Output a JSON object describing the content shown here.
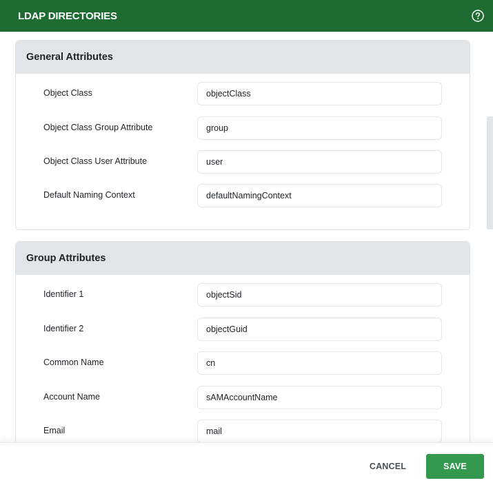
{
  "header": {
    "title": "LDAP DIRECTORIES",
    "help_icon": "help-circle-icon"
  },
  "sections": [
    {
      "title": "General Attributes",
      "fields": [
        {
          "label": "Object Class",
          "value": "objectClass"
        },
        {
          "label": "Object Class Group Attribute",
          "value": "group"
        },
        {
          "label": "Object Class User Attribute",
          "value": "user"
        },
        {
          "label": "Default Naming Context",
          "value": "defaultNamingContext"
        }
      ]
    },
    {
      "title": "Group Attributes",
      "fields": [
        {
          "label": "Identifier 1",
          "value": "objectSid"
        },
        {
          "label": "Identifier 2",
          "value": "objectGuid"
        },
        {
          "label": "Common Name",
          "value": "cn"
        },
        {
          "label": "Account Name",
          "value": "sAMAccountName"
        },
        {
          "label": "Email",
          "value": "mail"
        }
      ]
    }
  ],
  "footer": {
    "cancel_label": "CANCEL",
    "save_label": "SAVE"
  },
  "colors": {
    "header_bg": "#1f6c33",
    "save_bg": "#34994f",
    "section_header_bg": "#e2e5e8"
  }
}
